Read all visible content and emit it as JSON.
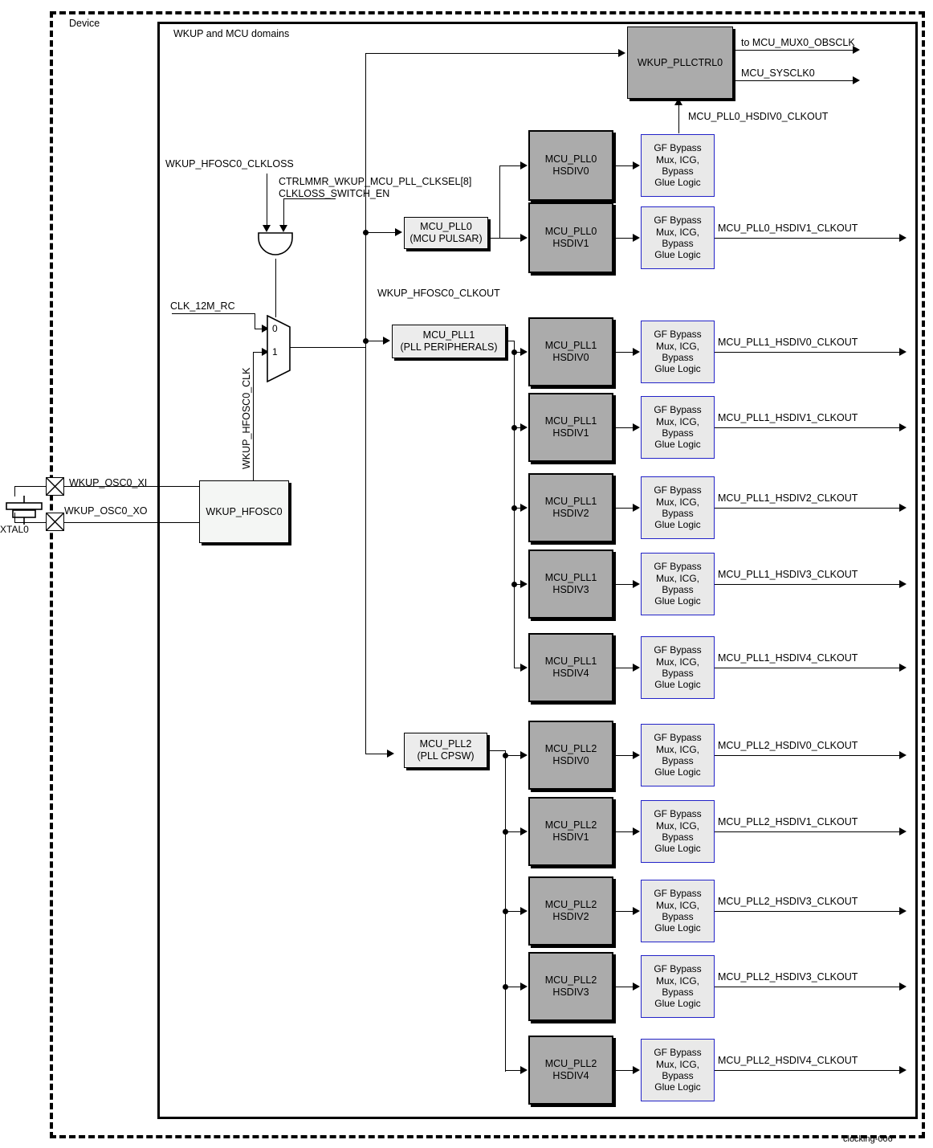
{
  "figure": {
    "footer_id": "clocking-006",
    "device_label": "Device",
    "domain_label": "WKUP and MCU domains"
  },
  "colors": {
    "hsdiv_fill": "#ababab",
    "pll_fill": "#ececec",
    "gf_fill": "#e9e9e9",
    "gf_border": "#2323c8",
    "line": "#000000"
  },
  "external": {
    "xtal_label": "XTAL0",
    "pad_xi_label": "WKUP_OSC0_XI",
    "pad_xo_label": "WKUP_OSC0_XO"
  },
  "signals": {
    "clkloss": "WKUP_HFOSC0_CLKLOSS",
    "clksel": "CTRLMMR_WKUP_MCU_PLL_CLKSEL[8]",
    "clkloss_switch_en": "CLKLOSS_SWITCH_EN",
    "clk_12m_rc": "CLK_12M_RC",
    "hfosc0_clk": "WKUP_HFOSC0_CLK",
    "hfosc0_clkout": "WKUP_HFOSC0_CLKOUT",
    "mux_sel_0": "0",
    "mux_sel_1": "1",
    "pll0_hsdiv0_clkout": "MCU_PLL0_HSDIV0_CLKOUT",
    "to_mcu_mux0_obsclk": "to MCU_MUX0_OBSCLK",
    "mcu_sysclk0": "MCU_SYSCLK0"
  },
  "blocks": {
    "osc": "WKUP_HFOSC0",
    "pllctrl0": "WKUP_PLLCTRL0",
    "pll0_line1": "MCU_PLL0",
    "pll0_line2": "(MCU PULSAR)",
    "pll1_line1": "MCU_PLL1",
    "pll1_line2": "(PLL PERIPHERALS)",
    "pll2_line1": "MCU_PLL2",
    "pll2_line2": "(PLL CPSW)",
    "gf": "GF Bypass\nMux, ICG,\nBypass\nGlue Logic",
    "gf_l1": "GF Bypass",
    "gf_l2": "Mux, ICG,",
    "gf_l3": "Bypass",
    "gf_l4": "Glue Logic"
  },
  "chains": [
    {
      "pll": "MCU_PLL0",
      "hsdivs": [
        {
          "line1": "MCU_PLL0",
          "line2": "HSDIV0",
          "clkout": "MCU_PLL0_HSDIV0_CLKOUT",
          "routes_to": "WKUP_PLLCTRL0"
        },
        {
          "line1": "MCU_PLL0",
          "line2": "HSDIV1",
          "clkout": "MCU_PLL0_HSDIV1_CLKOUT",
          "routes_to": "output"
        }
      ]
    },
    {
      "pll": "MCU_PLL1",
      "hsdivs": [
        {
          "line1": "MCU_PLL1",
          "line2": "HSDIV0",
          "clkout": "MCU_PLL1_HSDIV0_CLKOUT",
          "routes_to": "output"
        },
        {
          "line1": "MCU_PLL1",
          "line2": "HSDIV1",
          "clkout": "MCU_PLL1_HSDIV1_CLKOUT",
          "routes_to": "output"
        },
        {
          "line1": "MCU_PLL1",
          "line2": "HSDIV2",
          "clkout": "MCU_PLL1_HSDIV2_CLKOUT",
          "routes_to": "output"
        },
        {
          "line1": "MCU_PLL1",
          "line2": "HSDIV3",
          "clkout": "MCU_PLL1_HSDIV3_CLKOUT",
          "routes_to": "output"
        },
        {
          "line1": "MCU_PLL1",
          "line2": "HSDIV4",
          "clkout": "MCU_PLL1_HSDIV4_CLKOUT",
          "routes_to": "output"
        }
      ]
    },
    {
      "pll": "MCU_PLL2",
      "hsdivs": [
        {
          "line1": "MCU_PLL2",
          "line2": "HSDIV0",
          "clkout": "MCU_PLL2_HSDIV0_CLKOUT",
          "routes_to": "output"
        },
        {
          "line1": "MCU_PLL2",
          "line2": "HSDIV1",
          "clkout": "MCU_PLL2_HSDIV1_CLKOUT",
          "routes_to": "output"
        },
        {
          "line1": "MCU_PLL2",
          "line2": "HSDIV2",
          "clkout": "MCU_PLL2_HSDIV3_CLKOUT",
          "routes_to": "output"
        },
        {
          "line1": "MCU_PLL2",
          "line2": "HSDIV3",
          "clkout": "MCU_PLL2_HSDIV3_CLKOUT",
          "routes_to": "output"
        },
        {
          "line1": "MCU_PLL2",
          "line2": "HSDIV4",
          "clkout": "MCU_PLL2_HSDIV4_CLKOUT",
          "routes_to": "output"
        }
      ]
    }
  ]
}
